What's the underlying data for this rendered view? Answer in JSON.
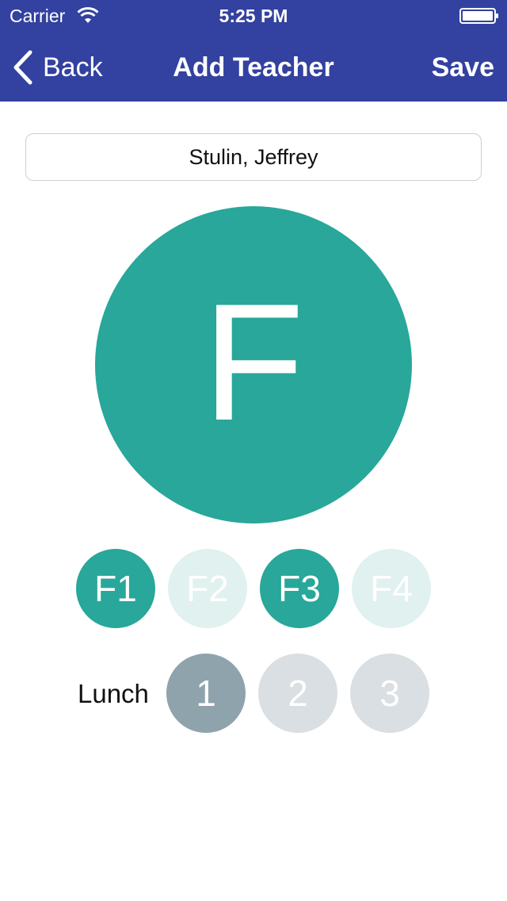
{
  "status_bar": {
    "carrier": "Carrier",
    "time": "5:25 PM"
  },
  "nav": {
    "back_label": "Back",
    "title": "Add Teacher",
    "save_label": "Save"
  },
  "form": {
    "name_value": "Stulin, Jeffrey"
  },
  "avatar": {
    "letter": "F",
    "color": "#28a79a"
  },
  "floors": [
    {
      "label": "F1",
      "selected": true
    },
    {
      "label": "F2",
      "selected": false
    },
    {
      "label": "F3",
      "selected": true
    },
    {
      "label": "F4",
      "selected": false
    }
  ],
  "lunch": {
    "label": "Lunch",
    "options": [
      {
        "label": "1",
        "selected": true
      },
      {
        "label": "2",
        "selected": false
      },
      {
        "label": "3",
        "selected": false
      }
    ]
  },
  "colors": {
    "header": "#3341a0",
    "accent": "#28a79a",
    "accent_light": "#e0f1ef",
    "lunch_selected": "#8fa3ac",
    "lunch_unselected": "#d9dfe2"
  }
}
